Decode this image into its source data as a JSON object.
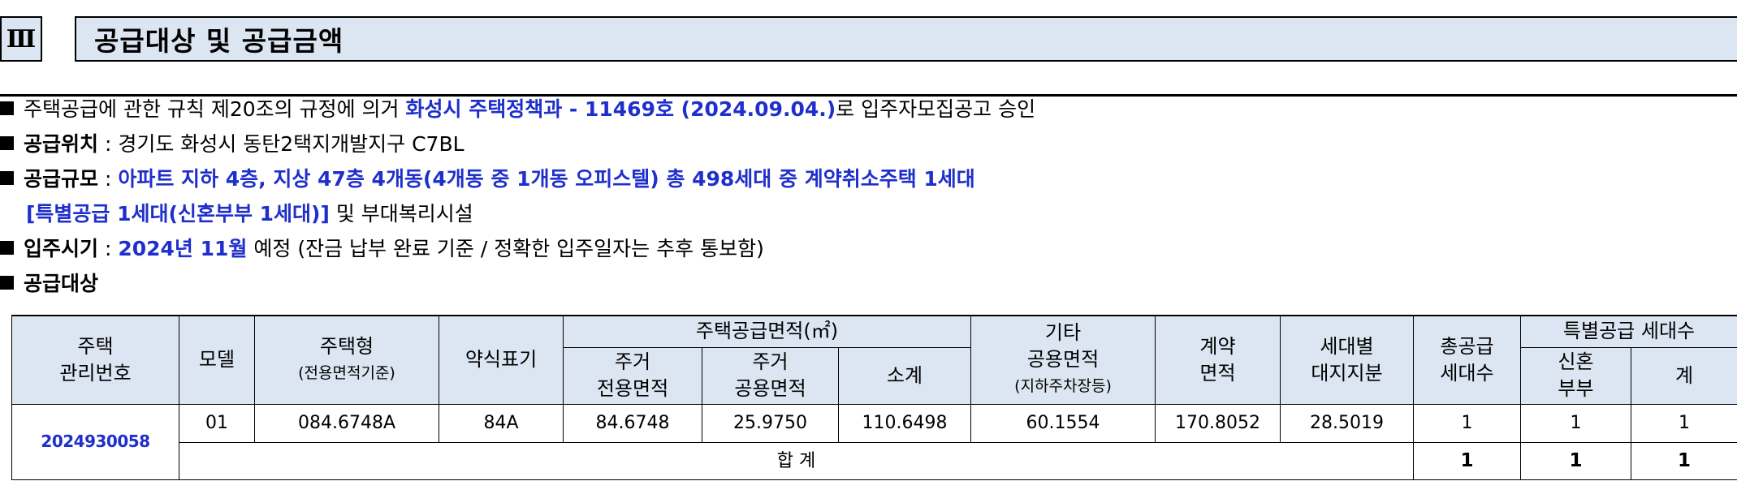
{
  "section": {
    "number": "Ⅲ",
    "title": "공급대상 및 공급금액"
  },
  "bullets": {
    "approval": {
      "prefix": "주택공급에 관한 규칙 제20조의 규정에 의거 ",
      "highlight": "화성시 주택정책과 - 11469호 (2024.09.04.)",
      "suffix": "로 입주자모집공고 승인"
    },
    "location": {
      "label": "공급위치",
      "sep": " : ",
      "value": "경기도 화성시 동탄2택지개발지구 C7BL"
    },
    "scale": {
      "label": "공급규모",
      "sep": " : ",
      "value_line1": "아파트 지하 4층, 지상 47층 4개동(4개동 중 1개동 오피스텔) 총 498세대 중 계약취소주택 1세대",
      "value_line2": "[특별공급 1세대(신혼부부 1세대)]",
      "suffix_line2": " 및 부대복리시설"
    },
    "move_in": {
      "label": "입주시기",
      "sep": " : ",
      "highlight": "2024년 11월",
      "suffix": " 예정 (잔금 납부 완료 기준 / 정확한 입주일자는 추후 통보함)"
    },
    "target": {
      "label": "공급대상"
    }
  },
  "table": {
    "headers": {
      "house_no_1": "주택",
      "house_no_2": "관리번호",
      "model": "모델",
      "type_1": "주택형",
      "type_2": "(전용면적기준)",
      "abbr": "약식표기",
      "supply_area": "주택공급면적(㎡)",
      "exclusive_1": "주거",
      "exclusive_2": "전용면적",
      "common_1": "주거",
      "common_2": "공용면적",
      "subtotal": "소계",
      "other_1": "기타",
      "other_2": "공용면적",
      "other_3": "(지하주차장등)",
      "contract_1": "계약",
      "contract_2": "면적",
      "land_1": "세대별",
      "land_2": "대지지분",
      "total_units_1": "총공급",
      "total_units_2": "세대수",
      "special": "특별공급 세대수",
      "newlywed_1": "신혼",
      "newlywed_2": "부부",
      "sum": "계"
    },
    "row": {
      "house_no": "2024930058",
      "model": "01",
      "type": "084.6748A",
      "abbr": "84A",
      "exclusive": "84.6748",
      "common": "25.9750",
      "subtotal": "110.6498",
      "other_common": "60.1554",
      "contract": "170.8052",
      "land_share": "28.5019",
      "total_units": "1",
      "newlywed": "1",
      "special_sum": "1"
    },
    "total_row": {
      "label": "합 계",
      "total_units": "1",
      "newlywed": "1",
      "special_sum": "1"
    }
  }
}
